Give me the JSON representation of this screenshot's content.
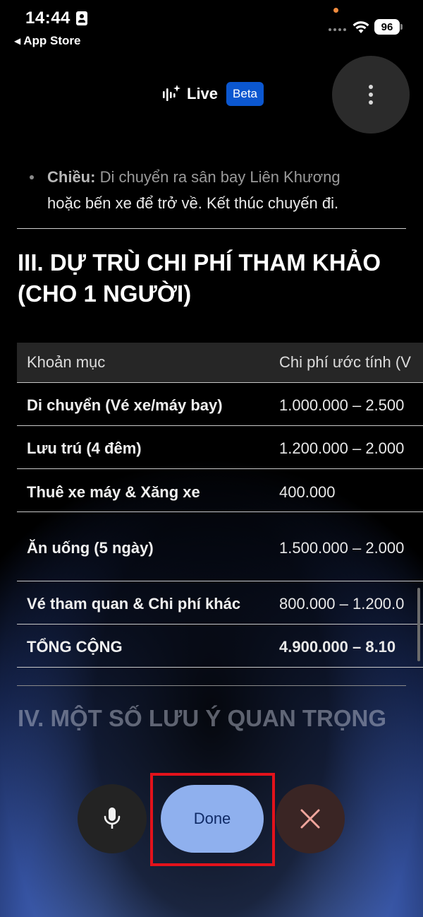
{
  "status_bar": {
    "time": "14:44",
    "back_label": "App Store",
    "battery": "96"
  },
  "header": {
    "title": "Live",
    "badge": "Beta"
  },
  "content": {
    "bullet_bold": "Chiều:",
    "bullet_text1": " Di chuyển ra sân bay Liên Khương",
    "bullet_text2": "hoặc bến xe để trở về. Kết thúc chuyến đi.",
    "section_title": "III. DỰ TRÙ CHI PHÍ THAM KHẢO (CHO 1 NGƯỜI)",
    "table": {
      "headers": [
        "Khoản mục",
        "Chi phí ước tính (V"
      ],
      "rows": [
        {
          "item": "Di chuyển (Vé xe/máy bay)",
          "cost": "1.000.000 – 2.500"
        },
        {
          "item": "Lưu trú (4 đêm)",
          "cost": "1.200.000 – 2.000"
        },
        {
          "item": "Thuê xe máy & Xăng xe",
          "cost": "400.000"
        },
        {
          "item": "Ăn uống (5 ngày)",
          "cost": "1.500.000 – 2.000"
        },
        {
          "item": "Vé tham quan & Chi phí khác",
          "cost": "800.000 – 1.200.0"
        },
        {
          "item": "TỔNG CỘNG",
          "cost": "4.900.000 – 8.10"
        }
      ]
    },
    "next_section_title": "IV. MỘT SỐ LƯU Ý QUAN TRỌNG"
  },
  "controls": {
    "done_label": "Done"
  },
  "colors": {
    "beta_badge": "#0b57d0",
    "done_button": "#8fb0ee",
    "highlight": "#e3121b",
    "close_x": "#f0a59c"
  }
}
